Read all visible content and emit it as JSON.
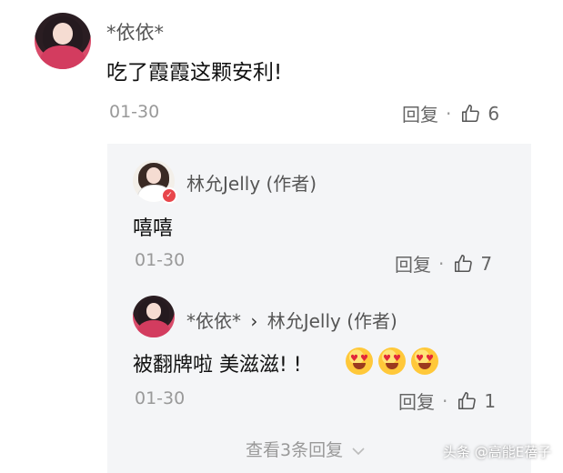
{
  "comment": {
    "author": "*依依*",
    "text": "吃了霞霞这颗安利!",
    "time": "01-30",
    "reply_label": "回复",
    "dot": "·",
    "like_count": "6"
  },
  "replies": [
    {
      "author": "林允Jelly (作者)",
      "text": "嘻嘻",
      "time": "01-30",
      "reply_label": "回复",
      "dot": "·",
      "like_count": "7"
    },
    {
      "author": "*依依*",
      "separator": "›",
      "reply_to": "林允Jelly (作者)",
      "text": "被翻牌啦 美滋滋! !",
      "emojis": [
        "heart-eyes-emoji",
        "heart-eyes-emoji",
        "heart-eyes-emoji"
      ],
      "time": "01-30",
      "reply_label": "回复",
      "dot": "·",
      "like_count": "1"
    }
  ],
  "more_replies": "查看3条回复",
  "watermark": "头条 @高能E蓓子",
  "colors": {
    "reply_bg": "#f4f5f7",
    "meta_gray": "#999999",
    "verified_badge": "#e8464b"
  }
}
